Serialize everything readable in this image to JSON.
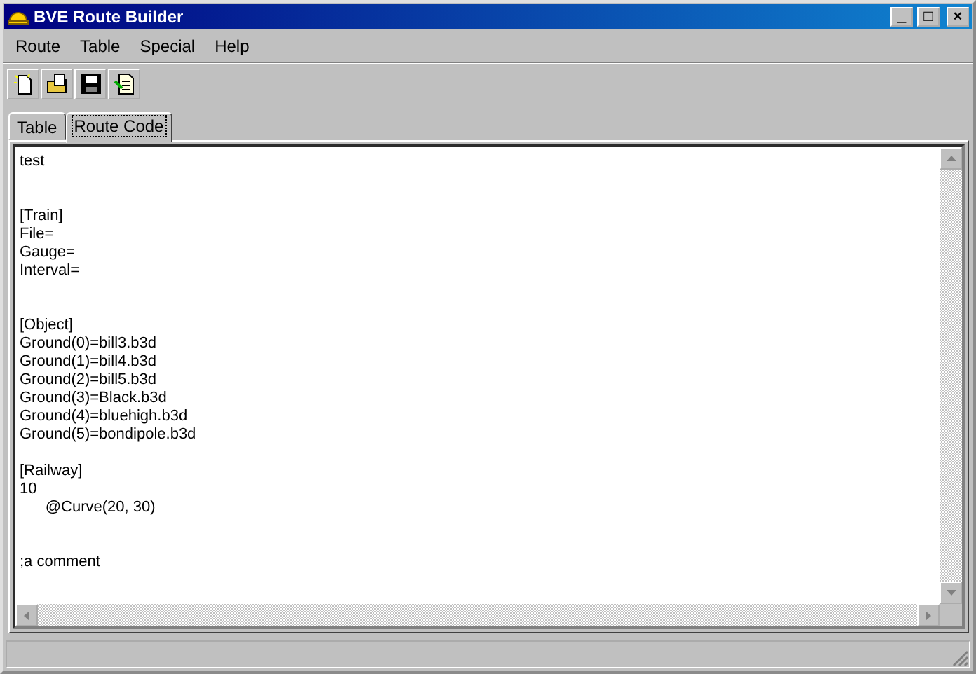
{
  "window": {
    "title": "BVE Route Builder",
    "controls": [
      "_",
      "□",
      "×"
    ]
  },
  "menu": [
    {
      "label": "Route"
    },
    {
      "label": "Table"
    },
    {
      "label": "Special"
    },
    {
      "label": "Help"
    }
  ],
  "toolbar": [
    {
      "kind": "new"
    },
    {
      "kind": "open"
    },
    {
      "kind": "save"
    },
    {
      "kind": "edit"
    }
  ],
  "tabs": [
    {
      "label": "Table",
      "selected": false
    },
    {
      "label": "Route Code",
      "selected": true
    }
  ],
  "editor": {
    "text": "test\n\n\n[Train]\nFile=\nGauge=\nInterval=\n\n\n[Object]\nGround(0)=bill3.b3d\nGround(1)=bill4.b3d\nGround(2)=bill5.b3d\nGround(3)=Black.b3d\nGround(4)=bluehigh.b3d\nGround(5)=bondipole.b3d\n\n[Railway]\n10\n\t@Curve(20, 30)\n\n\n;a comment"
  }
}
